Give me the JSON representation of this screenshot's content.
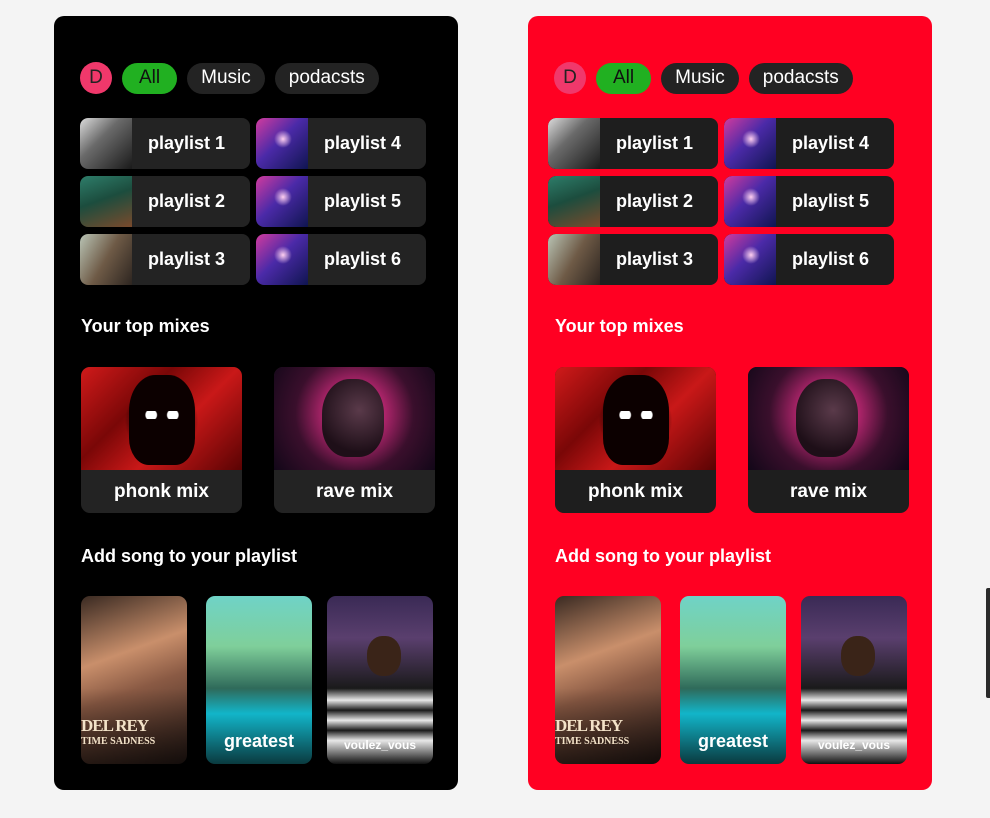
{
  "screens": [
    {
      "theme": "dark",
      "background": "#000000",
      "avatar_letter": "D",
      "filters": [
        "All",
        "Music",
        "podacsts"
      ],
      "active_filter": "All",
      "playlists": [
        "playlist 1",
        "playlist 4",
        "playlist 2",
        "playlist 5",
        "playlist 3",
        "playlist 6"
      ],
      "top_mixes_title": "Your top mixes",
      "mixes": [
        "phonk mix",
        "rave mix"
      ],
      "add_song_title": "Add song to your playlist",
      "songs": [
        "",
        "greatest",
        "voulez_vous"
      ]
    },
    {
      "theme": "red",
      "background": "#ff0022",
      "avatar_letter": "D",
      "filters": [
        "All",
        "Music",
        "podacsts"
      ],
      "active_filter": "All",
      "playlists": [
        "playlist 1",
        "playlist 4",
        "playlist 2",
        "playlist 5",
        "playlist 3",
        "playlist 6"
      ],
      "top_mixes_title": "Your top mixes",
      "mixes": [
        "phonk mix",
        "rave mix"
      ],
      "add_song_title": "Add song to your playlist",
      "songs": [
        "",
        "greatest",
        "voulez_vous"
      ]
    }
  ],
  "colors": {
    "accent_green": "#21b021",
    "avatar_pink": "#f0386b",
    "chip_bg": "#232323"
  }
}
